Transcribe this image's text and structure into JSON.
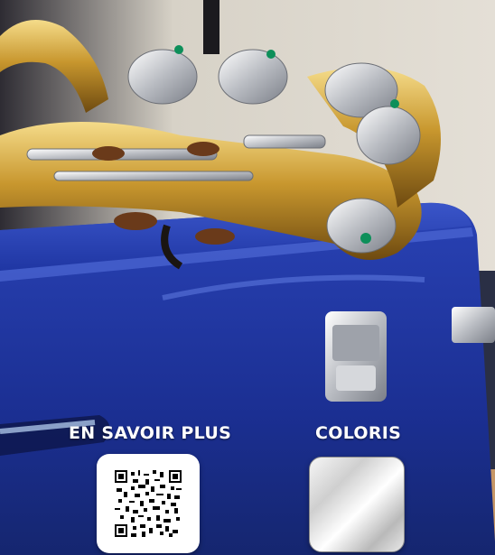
{
  "learn_more": {
    "label": "EN SAVOIR PLUS"
  },
  "colors": {
    "label": "COLORIS",
    "swatch_name": "silver",
    "swatch_color": "#d9d9d9"
  },
  "qr_code": {
    "icon": "qr-code-icon"
  },
  "photo": {
    "subject": "saxophone-on-case-image"
  }
}
